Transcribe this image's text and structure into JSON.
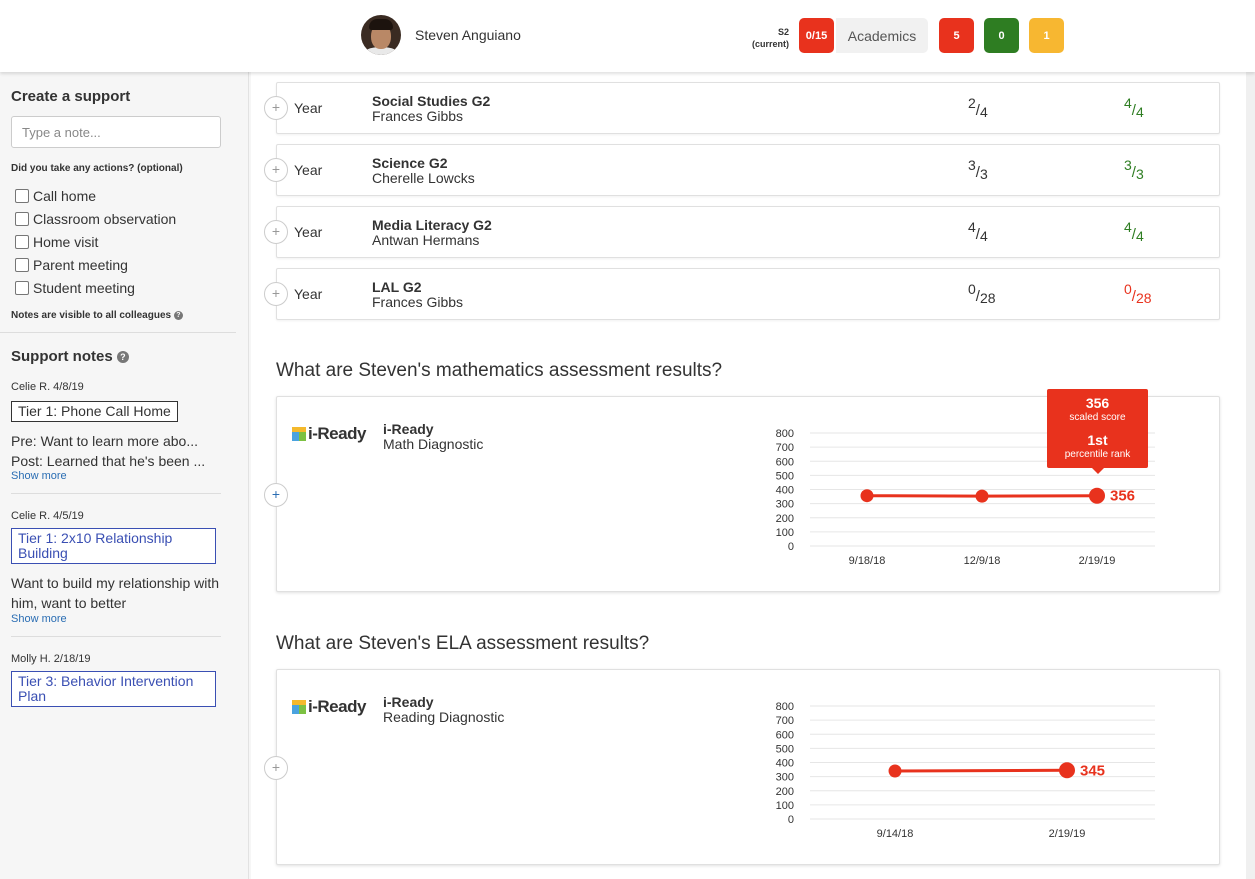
{
  "header": {
    "student_name": "Steven Anguiano",
    "term": "S2",
    "term_status": "(current)",
    "total_badge": "0/15",
    "academics_label": "Academics",
    "badge_red": "5",
    "badge_green": "0",
    "badge_yellow": "1"
  },
  "sidebar": {
    "create_title": "Create a support",
    "note_placeholder": "Type a note...",
    "actions_prompt": "Did you take any actions? (optional)",
    "actions": [
      "Call home",
      "Classroom observation",
      "Home visit",
      "Parent meeting",
      "Student meeting"
    ],
    "visibility_note": "Notes are visible to all colleagues",
    "support_notes_title": "Support notes",
    "notes": [
      {
        "meta": "Celie R. 4/8/19",
        "tier": "Tier 1: Phone Call Home",
        "line1": "Pre: Want to learn more abo...",
        "line2": "Post: Learned that he's been ...",
        "show_more": "Show more"
      },
      {
        "meta": "Celie R. 4/5/19",
        "tier": "Tier 1: 2x10 Relationship Building",
        "text": "Want to build my relationship with him, want to better",
        "show_more": "Show more"
      },
      {
        "meta": "Molly H. 2/18/19",
        "tier": "Tier 3: Behavior Intervention Plan"
      }
    ]
  },
  "courses": [
    {
      "period": "Year",
      "name": "Social Studies G2",
      "teacher": "Frances Gibbs",
      "score_a": {
        "num": "2",
        "den": "4"
      },
      "score_b": {
        "num": "4",
        "den": "4",
        "status": "green"
      }
    },
    {
      "period": "Year",
      "name": "Science G2",
      "teacher": "Cherelle Lowcks",
      "score_a": {
        "num": "3",
        "den": "3"
      },
      "score_b": {
        "num": "3",
        "den": "3",
        "status": "green"
      }
    },
    {
      "period": "Year",
      "name": "Media Literacy G2",
      "teacher": "Antwan Hermans",
      "score_a": {
        "num": "4",
        "den": "4"
      },
      "score_b": {
        "num": "4",
        "den": "4",
        "status": "green"
      }
    },
    {
      "period": "Year",
      "name": "LAL G2",
      "teacher": "Frances Gibbs",
      "score_a": {
        "num": "0",
        "den": "28"
      },
      "score_b": {
        "num": "0",
        "den": "28",
        "status": "red"
      }
    }
  ],
  "math": {
    "question": "What are Steven's mathematics assessment results?",
    "logo_text": "i-Ready",
    "assessment": "i-Ready",
    "subtitle": "Math Diagnostic",
    "tooltip": {
      "score": "356",
      "score_label": "scaled score",
      "percentile": "1st",
      "percentile_label": "percentile rank"
    }
  },
  "ela": {
    "question": "What are Steven's ELA assessment results?",
    "logo_text": "i-Ready",
    "assessment": "i-Ready",
    "subtitle": "Reading Diagnostic"
  },
  "colors": {
    "red": "#e8321d",
    "green": "#2e7d22",
    "yellow": "#f7b731",
    "link": "#2a6db3",
    "tier_blue": "#3a4fb3"
  },
  "chart_data": [
    {
      "type": "line",
      "x": [
        "9/18/18",
        "12/9/18",
        "2/19/19"
      ],
      "values": [
        356,
        353,
        356
      ],
      "last_label": "356",
      "ylim": [
        0,
        800
      ],
      "yticks": [
        800,
        700,
        600,
        500,
        400,
        300,
        200,
        100,
        0
      ],
      "grid": true
    },
    {
      "type": "line",
      "x": [
        "9/14/18",
        "2/19/19"
      ],
      "values": [
        340,
        345
      ],
      "last_label": "345",
      "ylim": [
        0,
        800
      ],
      "yticks": [
        800,
        700,
        600,
        500,
        400,
        300,
        200,
        100,
        0
      ],
      "grid": true
    }
  ]
}
